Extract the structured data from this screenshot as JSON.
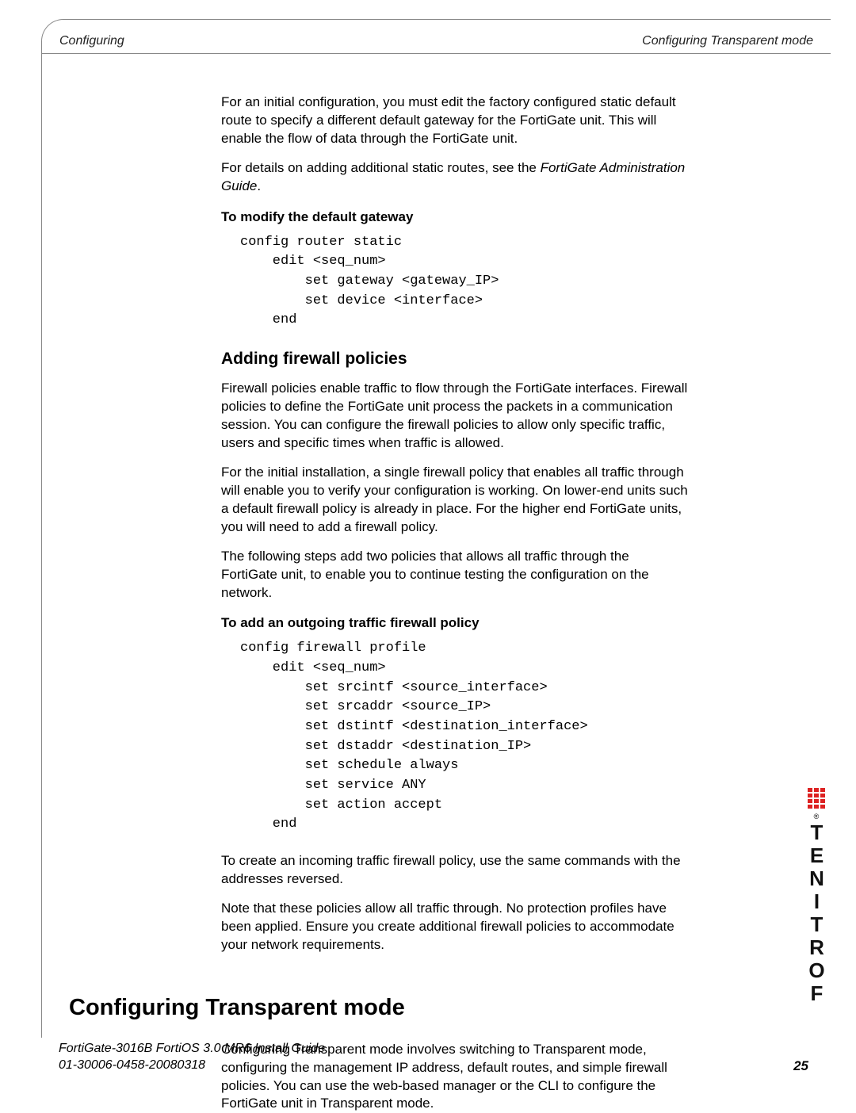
{
  "header": {
    "left": "Configuring",
    "right": "Configuring Transparent mode"
  },
  "body": {
    "p1a": "For an initial configuration, you must edit the factory configured static default route to specify a different default gateway for the FortiGate unit. This will enable the flow of data through the FortiGate unit.",
    "p1b_pre": "For details on adding additional static routes, see the ",
    "p1b_ital": "FortiGate Administration Guide",
    "p1b_post": ".",
    "instr1": "To modify the default gateway",
    "code1": "config router static\n    edit <seq_num>\n        set gateway <gateway_IP>\n        set device <interface>\n    end",
    "h2_firewall": "Adding firewall policies",
    "fw_p1": "Firewall policies enable traffic to flow through the FortiGate interfaces. Firewall policies to define the FortiGate unit process the packets in a communication session. You can configure the firewall policies to allow only specific traffic, users and specific times when traffic is allowed.",
    "fw_p2": "For the initial installation, a single firewall policy that enables all traffic through will enable you to verify your configuration is working. On lower-end units such a default firewall policy is already in place. For the higher end FortiGate units, you will need to add a firewall policy.",
    "fw_p3": "The following steps add two policies that allows all traffic through the FortiGate unit, to enable you to continue testing the configuration on the network.",
    "instr2": "To add an outgoing traffic firewall policy",
    "code2": "config firewall profile\n    edit <seq_num>\n        set srcintf <source_interface>\n        set srcaddr <source_IP>\n        set dstintf <destination_interface>\n        set dstaddr <destination_IP>\n        set schedule always\n        set service ANY\n        set action accept\n    end",
    "fw_p4": "To create an incoming traffic firewall policy, use the same commands with the addresses reversed.",
    "fw_p5": "Note that these policies allow all traffic through. No protection profiles have been applied. Ensure you create additional firewall policies to accommodate your network requirements.",
    "h1_transparent": "Configuring Transparent mode",
    "tp_p1": "Configuring Transparent mode involves switching to Transparent mode, configuring the management IP address, default routes, and simple firewall policies. You can use the web-based manager or the CLI to configure the FortiGate unit in Transparent mode."
  },
  "footer": {
    "line1": "FortiGate-3016B FortiOS 3.0 MR6 Install Guide",
    "line2": "01-30006-0458-20080318",
    "page": "25"
  },
  "logo": {
    "name": "FORTINET",
    "chars": [
      "F",
      "O",
      "R",
      "T",
      "I",
      "N",
      "E",
      "T"
    ],
    "reg": "®"
  }
}
